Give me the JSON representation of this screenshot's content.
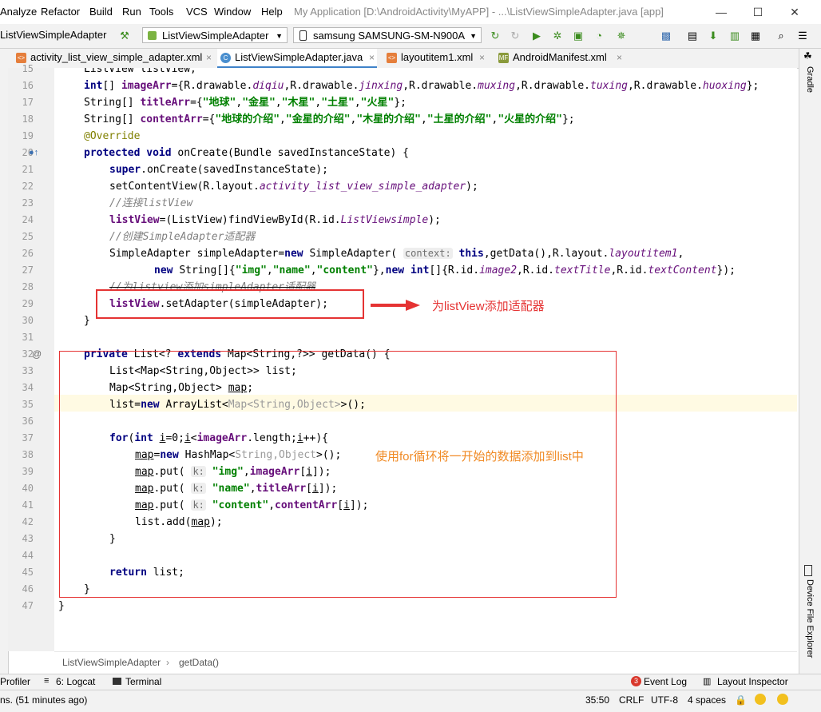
{
  "menu": [
    "Analyze",
    "Refactor",
    "Build",
    "Run",
    "Tools",
    "VCS",
    "Window",
    "Help"
  ],
  "window_title": "My Application [D:\\AndroidActivity\\MyAPP] - ...\\ListViewSimpleAdapter.java [app]",
  "toolbar": {
    "project_label": "ListViewSimpleAdapter",
    "config_select": "ListViewSimpleAdapter",
    "device_select": "samsung SAMSUNG-SM-N900A"
  },
  "tabs": [
    {
      "label": "activity_list_view_simple_adapter.xml",
      "icon": "xml-file-icon",
      "active": false
    },
    {
      "label": "ListViewSimpleAdapter.java",
      "icon": "java-class-icon",
      "active": true
    },
    {
      "label": "layoutitem1.xml",
      "icon": "xml-file-icon",
      "active": false
    },
    {
      "label": "AndroidManifest.xml",
      "icon": "manifest-file-icon",
      "active": false
    }
  ],
  "right_tools": {
    "gradle": "Gradle",
    "device_explorer": "Device File Explorer"
  },
  "line_numbers": [
    "15",
    "16",
    "17",
    "18",
    "19",
    "20",
    "21",
    "22",
    "23",
    "24",
    "25",
    "26",
    "27",
    "28",
    "29",
    "30",
    "31",
    "32",
    "33",
    "34",
    "35",
    "36",
    "37",
    "38",
    "39",
    "40",
    "41",
    "42",
    "43",
    "44",
    "45",
    "46",
    "47"
  ],
  "code": {
    "l15": "ListView listView;",
    "l16_a": "int",
    "l16_b": "[] ",
    "l16_c": "imageArr",
    "l16_d": "={R.drawable.",
    "l16_e": "diqiu",
    "l16_f": ",R.drawable.",
    "l16_g": "jinxing",
    "l16_h": ",R.drawable.",
    "l16_i": "muxing",
    "l16_j": ",R.drawable.",
    "l16_k": "tuxing",
    "l16_l": ",R.drawable.",
    "l16_m": "huoxing",
    "l16_n": "};",
    "l17_a": "String[] ",
    "l17_b": "titleArr",
    "l17_c": "={",
    "l17_d": "\"地球\"",
    "l17_e": ",",
    "l17_f": "\"金星\"",
    "l17_g": ",",
    "l17_h": "\"木星\"",
    "l17_i": ",",
    "l17_j": "\"土星\"",
    "l17_k": ",",
    "l17_l": "\"火星\"",
    "l17_m": "};",
    "l18_a": "String[] ",
    "l18_b": "contentArr",
    "l18_c": "={",
    "l18_d": "\"地球的介绍\"",
    "l18_e": ",",
    "l18_f": "\"金星的介绍\"",
    "l18_g": ",",
    "l18_h": "\"木星的介绍\"",
    "l18_i": ",",
    "l18_j": "\"土星的介绍\"",
    "l18_k": ",",
    "l18_l": "\"火星的介绍\"",
    "l18_m": "};",
    "l19": "@Override",
    "l20_a": "protected void ",
    "l20_b": "onCreate(Bundle savedInstanceState) {",
    "l21_a": "super",
    "l21_b": ".onCreate(savedInstanceState);",
    "l22_a": "setContentView(R.layout.",
    "l22_b": "activity_list_view_simple_adapter",
    "l22_c": ");",
    "l23": "//连接listView",
    "l24_a": "listView",
    "l24_b": "=(ListView)findViewById(R.id.",
    "l24_c": "ListViewsimple",
    "l24_d": ");",
    "l25": "//创建SimpleAdapter适配器",
    "l26_a": "SimpleAdapter simpleAdapter=",
    "l26_b": "new ",
    "l26_c": "SimpleAdapter( ",
    "l26_hint": "context:",
    "l26_d": " ",
    "l26_e": "this",
    "l26_f": ",getData(),R.layout.",
    "l26_g": "layoutitem1",
    "l26_h": ",",
    "l27_a": "new ",
    "l27_b": "String[]{",
    "l27_c": "\"img\"",
    "l27_d": ",",
    "l27_e": "\"name\"",
    "l27_f": ",",
    "l27_g": "\"content\"",
    "l27_h": "},",
    "l27_i": "new int",
    "l27_j": "[]{R.id.",
    "l27_k": "image2",
    "l27_l": ",R.id.",
    "l27_m": "textTitle",
    "l27_n": ",R.id.",
    "l27_o": "textContent",
    "l27_p": "});",
    "l28": "//为listview添加simpleAdapter适配器",
    "l29_a": "listView",
    "l29_b": ".setAdapter(simpleAdapter);",
    "l30": "}",
    "l32_a": "private ",
    "l32_b": "List<? ",
    "l32_c": "extends ",
    "l32_d": "Map<String,?>> getData() {",
    "l33": "List<Map<String,Object>> list;",
    "l34_a": "Map<String,Object> ",
    "l34_b": "map",
    "l34_c": ";",
    "l35_a": "list=",
    "l35_b": "new ",
    "l35_c": "ArrayList<",
    "l35_d": "Map<String,Object>",
    "l35_e": ">();",
    "l37_a": "for",
    "l37_b": "(",
    "l37_c": "int ",
    "l37_d": "i",
    "l37_e": "=0;",
    "l37_f": "i",
    "l37_g": "<",
    "l37_h": "imageArr",
    "l37_i": ".length;",
    "l37_j": "i",
    "l37_k": "++){",
    "l38_a": "map",
    "l38_b": "=",
    "l38_c": "new ",
    "l38_d": "HashMap<",
    "l38_e": "String,Object",
    "l38_f": ">();",
    "l39_a": "map",
    "l39_b": ".put( ",
    "l39_hint": "k:",
    "l39_c": " ",
    "l39_d": "\"img\"",
    "l39_e": ",",
    "l39_f": "imageArr",
    "l39_g": "[",
    "l39_h": "i",
    "l39_i": "]);",
    "l40_a": "map",
    "l40_b": ".put( ",
    "l40_hint": "k:",
    "l40_c": " ",
    "l40_d": "\"name\"",
    "l40_e": ",",
    "l40_f": "titleArr",
    "l40_g": "[",
    "l40_h": "i",
    "l40_i": "]);",
    "l41_a": "map",
    "l41_b": ".put( ",
    "l41_hint": "k:",
    "l41_c": " ",
    "l41_d": "\"content\"",
    "l41_e": ",",
    "l41_f": "contentArr",
    "l41_g": "[",
    "l41_h": "i",
    "l41_i": "]);",
    "l42_a": "list.add(",
    "l42_b": "map",
    "l42_c": ");",
    "l43": "}",
    "l45_a": "return ",
    "l45_b": "list;",
    "l46": "}",
    "l47": "}"
  },
  "annotations": {
    "adapter_note": "为listView添加适配器",
    "loop_note": "使用for循环将一开始的数据添加到list中"
  },
  "breadcrumb": [
    "ListViewSimpleAdapter",
    "getData()"
  ],
  "tool_tabs": {
    "profiler": "Profiler",
    "logcat": "6: Logcat",
    "terminal": "Terminal",
    "event_log": "Event Log",
    "event_log_count": "3",
    "layout_inspector": "Layout Inspector"
  },
  "status": {
    "message": "ns. (51 minutes ago)",
    "position": "35:50",
    "line_sep": "CRLF",
    "encoding": "UTF-8",
    "indent": "4 spaces"
  },
  "colors": {
    "accent": "#4083c9",
    "annotation_red": "#e53333",
    "note_orange": "#f08a24"
  }
}
